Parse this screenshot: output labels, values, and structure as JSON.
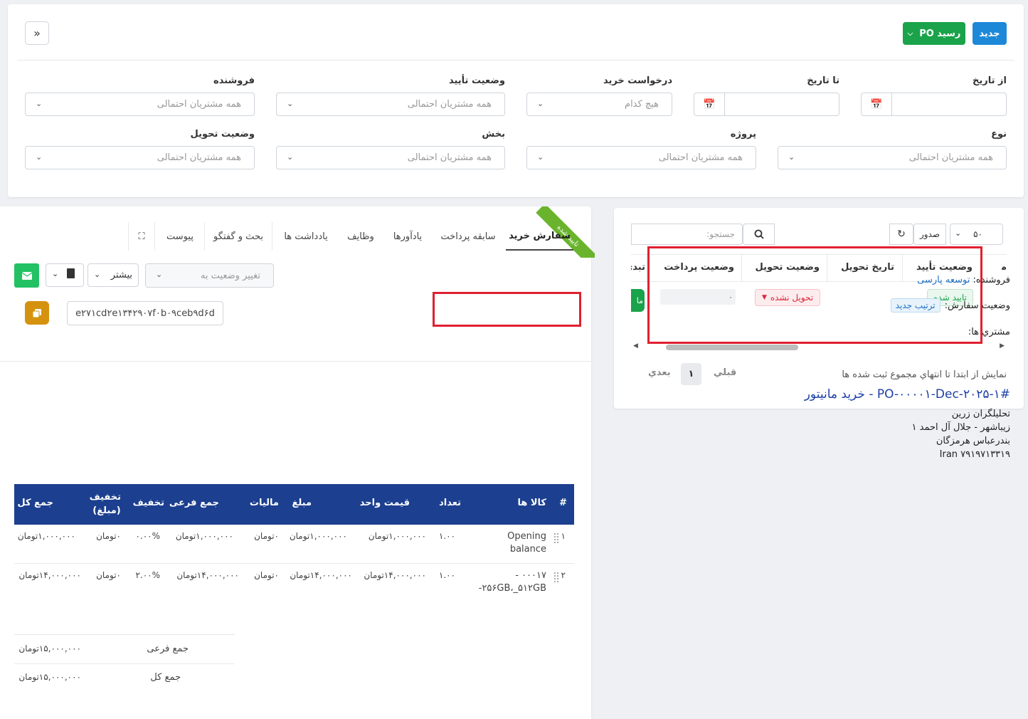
{
  "header": {
    "new_label": "جدید",
    "po_receipt_label": "رسید PO",
    "collapse_icon": "double-chevron-icon"
  },
  "filters": {
    "from_date": "از تاریخ",
    "to_date": "تا تاریخ",
    "purchase_request": "درخواست خرید",
    "purchase_request_value": "هیچ کدام",
    "approval_status": "وضعیت تأیید",
    "approval_status_value": "همه مشتریان احتمالی",
    "vendor": "فروشنده",
    "vendor_value": "همه مشتریان احتمالی",
    "type": "نوع",
    "type_value": "همه مشتریان احتمالی",
    "project": "پروژه",
    "project_value": "همه مشتریان احتمالی",
    "department": "بخش",
    "department_value": "همه مشتریان احتمالی",
    "delivery_status": "وضعیت تحویل",
    "delivery_status_value": "همه مشتریان احتمالی"
  },
  "list": {
    "page_size": "۵۰",
    "export_label": "صدور",
    "search_placeholder": "جستجو:",
    "columns": [
      "وضعیت تأیید",
      "تاریخ تحویل",
      "وضعیت تحویل",
      "وضعیت پرداخت",
      "تبدی",
      "ما"
    ],
    "row": {
      "approval": "تایید شده",
      "delivery_status": "تحویل نشده",
      "payment": "۰",
      "green_btn": "ما"
    },
    "footer": "نمایش از ابتدا تا انتهاي مجموع ثبت شده ها",
    "prev": "قبلي",
    "page": "۱",
    "next": "بعدي"
  },
  "detail": {
    "ribbon": "تایید شده",
    "tabs": [
      "سفارش خرید",
      "سابقه پرداخت",
      "یادآورها",
      "وظایف",
      "یادداشت ها",
      "بحث و گفتگو",
      "پیوست"
    ],
    "vendor_label": "فروشنده:",
    "vendor_value": "توسعه پارسی",
    "order_status_label": "وضعیت سفارش:",
    "order_status_value": "ترتیب جدید",
    "customers_label": "مشتري ها:",
    "change_status_placeholder": "تغییر وضعیت به",
    "more_label": "بیشتر",
    "hash": "e۲۷۱cd۲e۱۳۴۲۹۰۷f۰b۰۹ceb۹d۶d",
    "title": "#PO-۰۰۰۰۱-Dec-۲۰۲۵-۱ - خرید مانیتور",
    "address": [
      "تحلیلگران زرین",
      "زیباشهر - جلال آل احمد ۱",
      "بندرعباس هرمزگان",
      "Iran ۷۹۱۹۷۱۳۳۱۹"
    ],
    "table_headers": {
      "num": "#",
      "items": "کالا ها",
      "qty": "تعداد",
      "unit_price": "قیمت واحد",
      "amount": "مبلغ",
      "tax": "مالیات",
      "subtotal": "جمع فرعی",
      "discount": "تخفیف",
      "discount_amount": "تخفیف (مبلغ)",
      "total": "جمع کل"
    },
    "rows": [
      {
        "num": "۱",
        "item": "Opening balance",
        "qty": "۱.۰۰",
        "unit_price": "۱,۰۰۰,۰۰۰تومان",
        "amount": "۱,۰۰۰,۰۰۰تومان",
        "tax": "۰تومان",
        "subtotal": "۱,۰۰۰,۰۰۰تومان",
        "discount": "۰.۰۰%",
        "discount_amount": "۰تومان",
        "total": "۱,۰۰۰,۰۰۰تومان"
      },
      {
        "num": "۲",
        "item": "۰۰۰۱۷ - ۲۵۶GB،_۵۱۲GB-",
        "qty": "۱.۰۰",
        "unit_price": "۱۴,۰۰۰,۰۰۰تومان",
        "amount": "۱۴,۰۰۰,۰۰۰تومان",
        "tax": "۰تومان",
        "subtotal": "۱۴,۰۰۰,۰۰۰تومان",
        "discount": "۲.۰۰%",
        "discount_amount": "۰تومان",
        "total": "۱۴,۰۰۰,۰۰۰تومان"
      }
    ],
    "summary": {
      "subtotal_label": "جمع فرعی",
      "subtotal_value": "۱۵,۰۰۰,۰۰۰تومان",
      "total_label": "جمع کل",
      "total_value": "۱۵,۰۰۰,۰۰۰تومان"
    }
  },
  "colors": {
    "blue": "#1e88d8",
    "green": "#1aa34a",
    "navy": "#1c3f8f",
    "red": "#e02030",
    "gold": "#d4920f"
  }
}
